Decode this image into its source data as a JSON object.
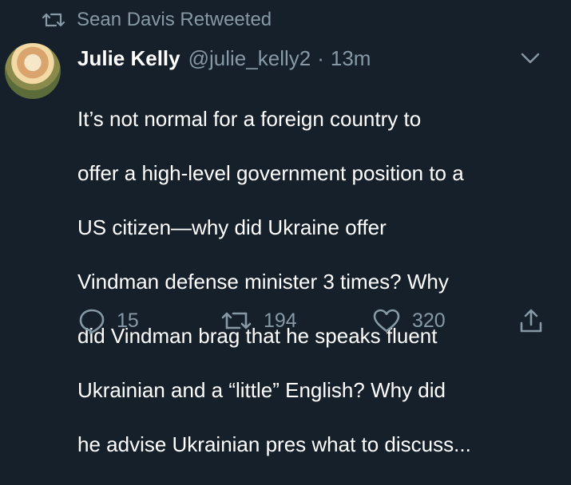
{
  "retweet_context": {
    "icon": "retweet-icon",
    "text": "Sean Davis Retweeted"
  },
  "tweet": {
    "author_name": "Julie Kelly",
    "handle": "@julie_kelly2",
    "separator": "·",
    "time": "13m",
    "lines": [
      "It’s not normal for a foreign country to",
      "offer a high-level government position to a",
      "US citizen—why did Ukraine offer",
      "Vindman defense minister 3 times? Why",
      "did Vindman brag that he speaks fluent",
      "Ukrainian and a “little” English? Why did",
      "he advise Ukrainian pres what to discuss..."
    ]
  },
  "actions": {
    "reply_count": "15",
    "retweet_count": "194",
    "like_count": "320"
  },
  "colors": {
    "background": "#15202b",
    "text": "#ffffff",
    "secondary": "#8899a6"
  }
}
